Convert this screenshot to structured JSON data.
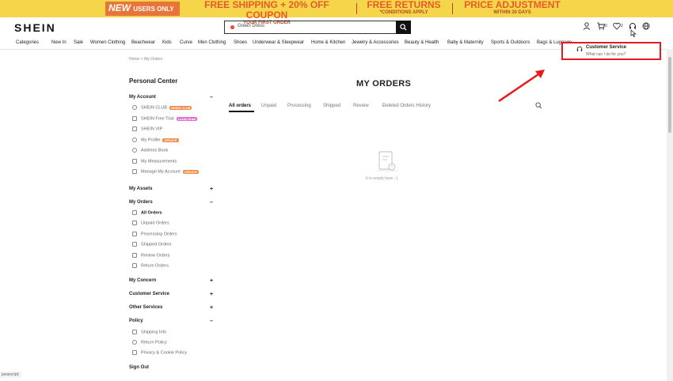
{
  "promo": {
    "new_word": "NEW",
    "new_rest": "USERS ONLY",
    "shipping_main": "FREE SHIPPING + 20% OFF COUPON",
    "shipping_sub": "YOUR FIRST ORDER",
    "returns_main": "FREE RETURNS",
    "returns_sub": "*CONDITIONS APPLY",
    "price_main": "PRICE ADJUSTMENT",
    "price_sub": "WITHIN 30 DAYS"
  },
  "header": {
    "logo": "SHEIN",
    "search_placeholder": "Green Dress",
    "cart_count": "0",
    "wishlist_count": "2"
  },
  "nav": [
    "Categories",
    "New In",
    "Sale",
    "Women Clothing",
    "Beachwear",
    "Kids",
    "Curve",
    "Men Clothing",
    "Shoes",
    "Underwear & Sleepwear",
    "Home & Kitchen",
    "Jewelry & Accessories",
    "Beauty & Health",
    "Baby & Maternity",
    "Sports & Outdoors",
    "Bags & Luggage"
  ],
  "cs_popup": {
    "title": "Customer Service",
    "subtitle": "What can I do for you?"
  },
  "breadcrumb": "Home > My Orders",
  "sidebar": {
    "heading": "Personal Center",
    "my_account": "My Account",
    "account_items": [
      {
        "label": "SHEIN CLUB",
        "tag": "SHEIN CLUB"
      },
      {
        "label": "SHEIN Free Trial",
        "tag": "Lucky Draw"
      },
      {
        "label": "SHEIN VIP",
        "tag": ""
      },
      {
        "label": "My Profile",
        "tag": "UPDATE"
      },
      {
        "label": "Address Book",
        "tag": ""
      },
      {
        "label": "My Measurements",
        "tag": ""
      },
      {
        "label": "Manage My Account",
        "tag": "UPDATE"
      }
    ],
    "my_assets": "My Assets",
    "my_orders": "My Orders",
    "order_items": [
      "All Orders",
      "Unpaid Orders",
      "Processing Orders",
      "Shipped Orders",
      "Review Orders",
      "Return Orders"
    ],
    "my_concern": "My Concern",
    "customer_service": "Customer Service",
    "other_services": "Other Services",
    "policy": "Policy",
    "policy_items": [
      "Shipping Info",
      "Return Policy",
      "Privacy & Cookie Policy"
    ],
    "sign_out": "Sign Out",
    "plus": "+",
    "minus": "–"
  },
  "main": {
    "title": "MY ORDERS",
    "tabs": [
      "All orders",
      "Unpaid",
      "Processing",
      "Shipped",
      "Review",
      "Deleted Orders History"
    ],
    "empty_text": "It is empty here :-)"
  },
  "status_bar": "javascript:",
  "colors": {
    "promo_bg": "#f5d64a",
    "promo_text": "#e85a2a",
    "highlight": "#e8181c",
    "tag_orange": "#f08a4b",
    "tag_pink": "#e26cd0"
  }
}
